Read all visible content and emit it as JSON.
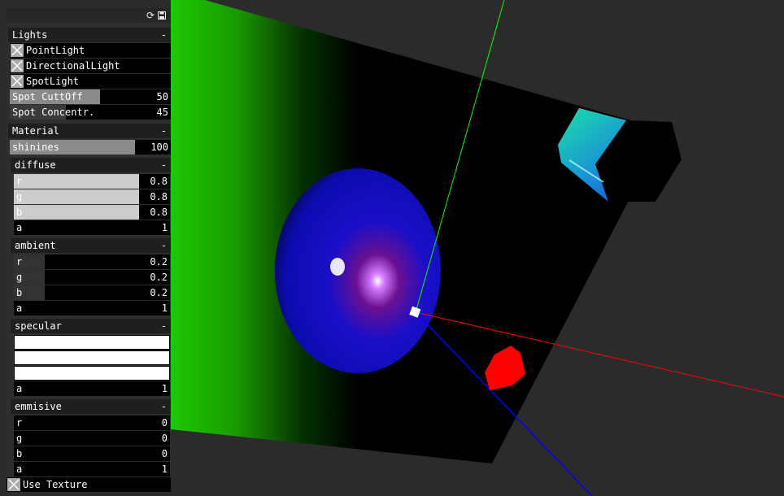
{
  "toolbar": {
    "refresh_icon": "refresh-icon",
    "save_icon": "save-icon"
  },
  "lights": {
    "title": "Lights",
    "collapse": "-",
    "toggles": [
      {
        "label": "PointLight",
        "checked": true
      },
      {
        "label": "DirectionalLight",
        "checked": true
      },
      {
        "label": "SpotLight",
        "checked": true
      }
    ],
    "spot_cutoff": {
      "label": "Spot CuttOff",
      "value": "50",
      "fraction": 0.56
    },
    "spot_concentration": {
      "label": "Spot Concentr.",
      "value": "45",
      "fraction": 0.35
    }
  },
  "material": {
    "title": "Material",
    "collapse": "-",
    "shininess": {
      "label": "shinines",
      "value": "100",
      "fraction": 0.78
    },
    "diffuse": {
      "title": "diffuse",
      "collapse": "-",
      "r": {
        "label": "r",
        "value": "0.8",
        "fraction": 0.8
      },
      "g": {
        "label": "g",
        "value": "0.8",
        "fraction": 0.8
      },
      "b": {
        "label": "b",
        "value": "0.8",
        "fraction": 0.8
      },
      "a": {
        "label": "a",
        "value": "1"
      }
    },
    "ambient": {
      "title": "ambient",
      "collapse": "-",
      "r": {
        "label": "r",
        "value": "0.2",
        "fraction": 0.2
      },
      "g": {
        "label": "g",
        "value": "0.2",
        "fraction": 0.2
      },
      "b": {
        "label": "b",
        "value": "0.2",
        "fraction": 0.2
      },
      "a": {
        "label": "a",
        "value": "1"
      }
    },
    "specular": {
      "title": "specular",
      "collapse": "-",
      "a": {
        "label": "a",
        "value": "1"
      }
    },
    "emissive": {
      "title": "emmisive",
      "collapse": "-",
      "r": {
        "label": "r",
        "value": "0"
      },
      "g": {
        "label": "g",
        "value": "0"
      },
      "b": {
        "label": "b",
        "value": "0"
      },
      "a": {
        "label": "a",
        "value": "1"
      }
    }
  },
  "use_texture": {
    "label": "Use Texture",
    "checked": true
  },
  "colors": {
    "panel_bg": "#2e2e2e",
    "slider_fill": "#8a8a8a",
    "slider_fill_light": "#cccccc",
    "viewport_bg": "#2b2b2b",
    "axis_x": "#ff0000",
    "axis_y": "#00ff00",
    "axis_z": "#0000ff"
  }
}
